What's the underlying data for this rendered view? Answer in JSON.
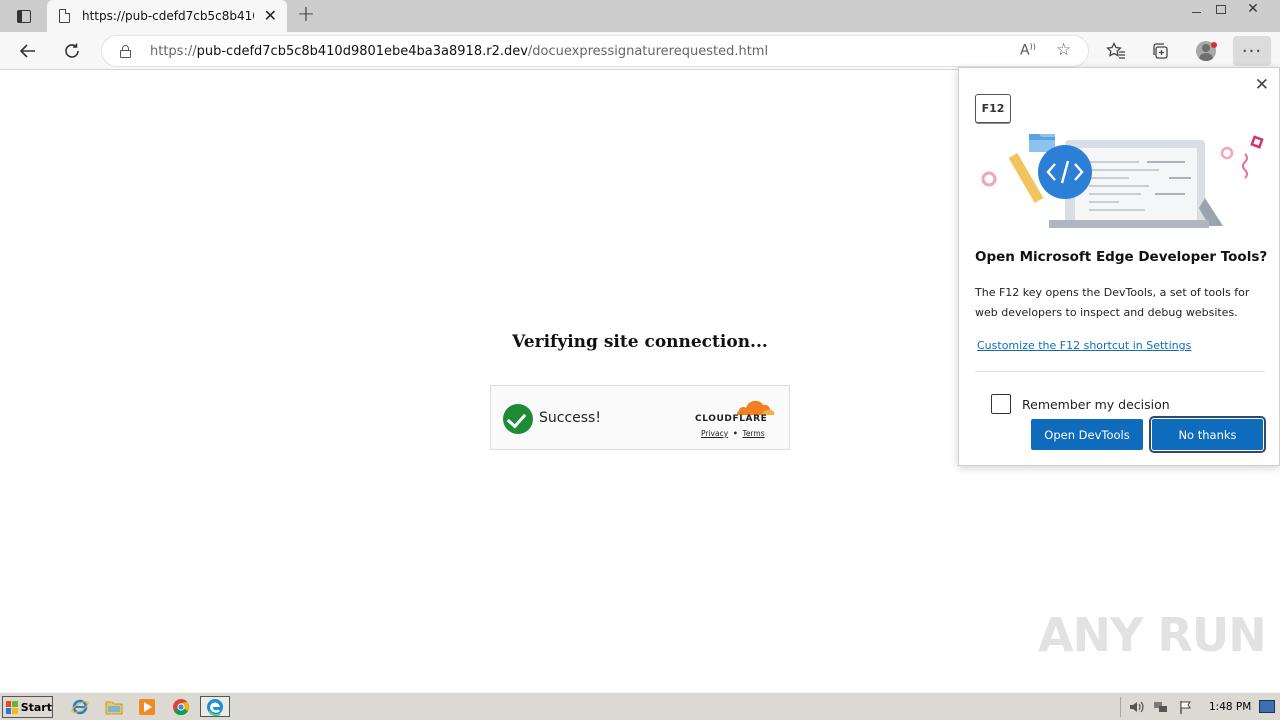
{
  "browser": {
    "tab": {
      "title": "https://pub-cdefd7cb5c8b410d9801ebe4ba3a8918.r2.dev/docuexpressignaturerequested.html"
    },
    "new_tab": "+",
    "window_controls": {
      "close": "✕"
    },
    "address": {
      "scheme": "https://",
      "host": "pub-cdefd7cb5c8b410d9801ebe4ba3a8918.r2.dev",
      "path": "/docuexpressignaturerequested.html"
    },
    "read_aloud": "A",
    "more_menu": "···"
  },
  "page": {
    "title": "Verifying site connection...",
    "widget": {
      "status": "Success!",
      "brand": "CLOUDFLARE",
      "privacy_link": "Privacy",
      "separator": "•",
      "terms_link": "Terms"
    }
  },
  "devtools_popup": {
    "key_label": "F12",
    "close": "✕",
    "heading": "Open Microsoft Edge Developer Tools?",
    "body": "The F12 key opens the DevTools, a set of tools for web developers to inspect and debug websites.",
    "customize_link": "Customize the F12 shortcut in Settings",
    "remember_label": "Remember my decision",
    "remember_checked": false,
    "open_button": "Open DevTools",
    "decline_button": "No thanks"
  },
  "watermark": "ANY RUN",
  "taskbar": {
    "start_label": "Start",
    "clock": "1:48 PM"
  },
  "colors": {
    "accent": "#0f6cbd",
    "success": "#1e8c35",
    "cloudflare_orange": "#f38020"
  }
}
